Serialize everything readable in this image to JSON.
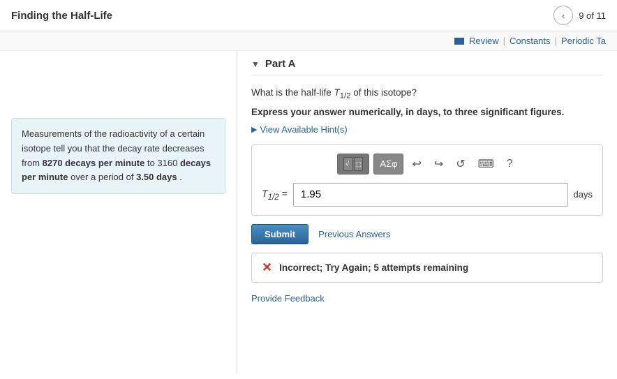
{
  "header": {
    "title": "Finding the Half-Life",
    "nav_prev_label": "‹",
    "nav_count": "9 of 11"
  },
  "topnav": {
    "review_label": "Review",
    "constants_label": "Constants",
    "periodic_label": "Periodic Ta"
  },
  "left_panel": {
    "info_text_1": "Measurements of the radioactivity of a certain isotope tell you that the decay rate decreases from",
    "info_bold_1": "8270 decays per minute",
    "info_text_2": " to 3160",
    "info_bold_2": "decays per minute",
    "info_text_3": " over a period of",
    "info_bold_3": "3.50 days",
    "info_text_4": " ."
  },
  "part": {
    "label": "Part A"
  },
  "question": {
    "text": "What is the half-life T₁₂ of this isotope?",
    "emphasis": "Express your answer numerically, in days, to three significant figures."
  },
  "hint": {
    "label": "View Available Hint(s)"
  },
  "toolbar": {
    "math_btn": "√⬚",
    "formula_btn": "ΑΣφ",
    "undo_icon": "↩",
    "redo_icon": "↪",
    "reset_icon": "↺",
    "keyboard_icon": "⌨",
    "help_icon": "?"
  },
  "input": {
    "label_text": "T₁₂ =",
    "value": "1.95",
    "unit": "days",
    "placeholder": ""
  },
  "submit": {
    "label": "Submit"
  },
  "prev_answers": {
    "label": "Previous Answers"
  },
  "error": {
    "icon": "✕",
    "text": "Incorrect; Try Again; 5 attempts remaining"
  },
  "feedback": {
    "label": "Provide Feedback"
  },
  "colors": {
    "accent_blue": "#2a6496",
    "info_bg": "#e8f4f8",
    "error_red": "#c0392b"
  }
}
